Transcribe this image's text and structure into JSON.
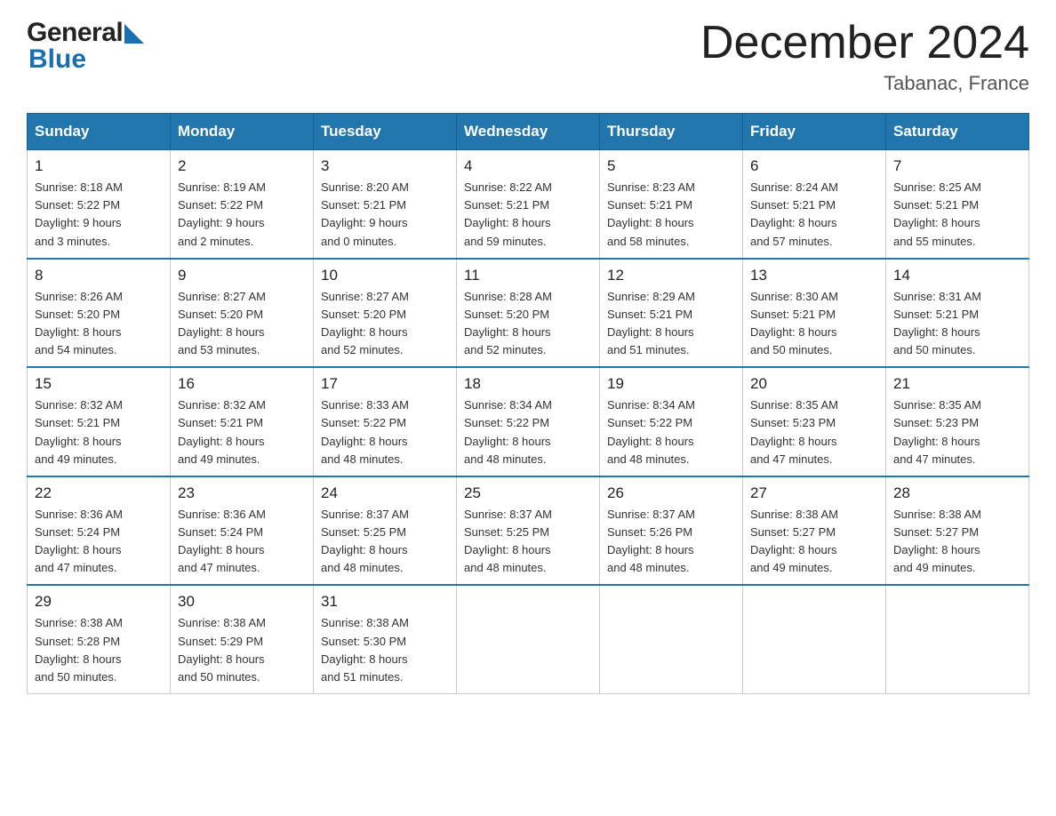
{
  "logo": {
    "general": "General",
    "blue": "Blue",
    "triangle": "▲"
  },
  "title": "December 2024",
  "location": "Tabanac, France",
  "days_of_week": [
    "Sunday",
    "Monday",
    "Tuesday",
    "Wednesday",
    "Thursday",
    "Friday",
    "Saturday"
  ],
  "weeks": [
    [
      {
        "day": "1",
        "info": "Sunrise: 8:18 AM\nSunset: 5:22 PM\nDaylight: 9 hours\nand 3 minutes."
      },
      {
        "day": "2",
        "info": "Sunrise: 8:19 AM\nSunset: 5:22 PM\nDaylight: 9 hours\nand 2 minutes."
      },
      {
        "day": "3",
        "info": "Sunrise: 8:20 AM\nSunset: 5:21 PM\nDaylight: 9 hours\nand 0 minutes."
      },
      {
        "day": "4",
        "info": "Sunrise: 8:22 AM\nSunset: 5:21 PM\nDaylight: 8 hours\nand 59 minutes."
      },
      {
        "day": "5",
        "info": "Sunrise: 8:23 AM\nSunset: 5:21 PM\nDaylight: 8 hours\nand 58 minutes."
      },
      {
        "day": "6",
        "info": "Sunrise: 8:24 AM\nSunset: 5:21 PM\nDaylight: 8 hours\nand 57 minutes."
      },
      {
        "day": "7",
        "info": "Sunrise: 8:25 AM\nSunset: 5:21 PM\nDaylight: 8 hours\nand 55 minutes."
      }
    ],
    [
      {
        "day": "8",
        "info": "Sunrise: 8:26 AM\nSunset: 5:20 PM\nDaylight: 8 hours\nand 54 minutes."
      },
      {
        "day": "9",
        "info": "Sunrise: 8:27 AM\nSunset: 5:20 PM\nDaylight: 8 hours\nand 53 minutes."
      },
      {
        "day": "10",
        "info": "Sunrise: 8:27 AM\nSunset: 5:20 PM\nDaylight: 8 hours\nand 52 minutes."
      },
      {
        "day": "11",
        "info": "Sunrise: 8:28 AM\nSunset: 5:20 PM\nDaylight: 8 hours\nand 52 minutes."
      },
      {
        "day": "12",
        "info": "Sunrise: 8:29 AM\nSunset: 5:21 PM\nDaylight: 8 hours\nand 51 minutes."
      },
      {
        "day": "13",
        "info": "Sunrise: 8:30 AM\nSunset: 5:21 PM\nDaylight: 8 hours\nand 50 minutes."
      },
      {
        "day": "14",
        "info": "Sunrise: 8:31 AM\nSunset: 5:21 PM\nDaylight: 8 hours\nand 50 minutes."
      }
    ],
    [
      {
        "day": "15",
        "info": "Sunrise: 8:32 AM\nSunset: 5:21 PM\nDaylight: 8 hours\nand 49 minutes."
      },
      {
        "day": "16",
        "info": "Sunrise: 8:32 AM\nSunset: 5:21 PM\nDaylight: 8 hours\nand 49 minutes."
      },
      {
        "day": "17",
        "info": "Sunrise: 8:33 AM\nSunset: 5:22 PM\nDaylight: 8 hours\nand 48 minutes."
      },
      {
        "day": "18",
        "info": "Sunrise: 8:34 AM\nSunset: 5:22 PM\nDaylight: 8 hours\nand 48 minutes."
      },
      {
        "day": "19",
        "info": "Sunrise: 8:34 AM\nSunset: 5:22 PM\nDaylight: 8 hours\nand 48 minutes."
      },
      {
        "day": "20",
        "info": "Sunrise: 8:35 AM\nSunset: 5:23 PM\nDaylight: 8 hours\nand 47 minutes."
      },
      {
        "day": "21",
        "info": "Sunrise: 8:35 AM\nSunset: 5:23 PM\nDaylight: 8 hours\nand 47 minutes."
      }
    ],
    [
      {
        "day": "22",
        "info": "Sunrise: 8:36 AM\nSunset: 5:24 PM\nDaylight: 8 hours\nand 47 minutes."
      },
      {
        "day": "23",
        "info": "Sunrise: 8:36 AM\nSunset: 5:24 PM\nDaylight: 8 hours\nand 47 minutes."
      },
      {
        "day": "24",
        "info": "Sunrise: 8:37 AM\nSunset: 5:25 PM\nDaylight: 8 hours\nand 48 minutes."
      },
      {
        "day": "25",
        "info": "Sunrise: 8:37 AM\nSunset: 5:25 PM\nDaylight: 8 hours\nand 48 minutes."
      },
      {
        "day": "26",
        "info": "Sunrise: 8:37 AM\nSunset: 5:26 PM\nDaylight: 8 hours\nand 48 minutes."
      },
      {
        "day": "27",
        "info": "Sunrise: 8:38 AM\nSunset: 5:27 PM\nDaylight: 8 hours\nand 49 minutes."
      },
      {
        "day": "28",
        "info": "Sunrise: 8:38 AM\nSunset: 5:27 PM\nDaylight: 8 hours\nand 49 minutes."
      }
    ],
    [
      {
        "day": "29",
        "info": "Sunrise: 8:38 AM\nSunset: 5:28 PM\nDaylight: 8 hours\nand 50 minutes."
      },
      {
        "day": "30",
        "info": "Sunrise: 8:38 AM\nSunset: 5:29 PM\nDaylight: 8 hours\nand 50 minutes."
      },
      {
        "day": "31",
        "info": "Sunrise: 8:38 AM\nSunset: 5:30 PM\nDaylight: 8 hours\nand 51 minutes."
      },
      {
        "day": "",
        "info": ""
      },
      {
        "day": "",
        "info": ""
      },
      {
        "day": "",
        "info": ""
      },
      {
        "day": "",
        "info": ""
      }
    ]
  ]
}
